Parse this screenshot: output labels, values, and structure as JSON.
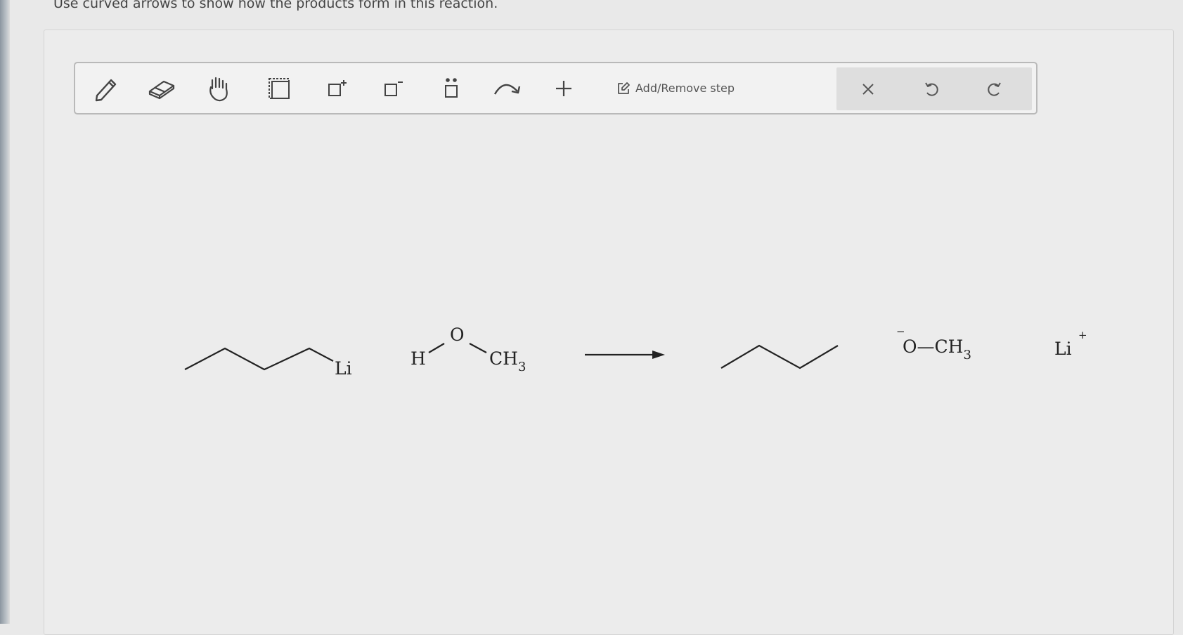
{
  "prompt": "Use curved arrows to show how the products form in this reaction.",
  "toolbar": {
    "tools": [
      {
        "name": "pencil-icon",
        "label": ""
      },
      {
        "name": "eraser-icon",
        "label": ""
      },
      {
        "name": "hand-icon",
        "label": ""
      },
      {
        "name": "select-box-icon",
        "label": ""
      },
      {
        "name": "positive-charge-icon",
        "label": "+"
      },
      {
        "name": "negative-charge-icon",
        "label": "−"
      },
      {
        "name": "lone-pair-icon",
        "label": ""
      },
      {
        "name": "curved-arrow-icon",
        "label": ""
      },
      {
        "name": "plus-icon",
        "label": "+"
      }
    ],
    "add_remove_step_label": "Add/Remove step",
    "actions": [
      {
        "name": "clear-icon",
        "glyph": "×"
      },
      {
        "name": "undo-icon",
        "glyph": "↶"
      },
      {
        "name": "redo-icon",
        "glyph": "↷"
      }
    ]
  },
  "reaction": {
    "reactant1": {
      "atom": "Li"
    },
    "reactant2": {
      "h": "H",
      "o": "O",
      "ch": "CH",
      "sub": "3"
    },
    "product2": {
      "charge": "−",
      "o": "O",
      "bond": "—",
      "ch": "CH",
      "sub": "3"
    },
    "product3": {
      "atom": "Li",
      "charge": "+"
    }
  }
}
